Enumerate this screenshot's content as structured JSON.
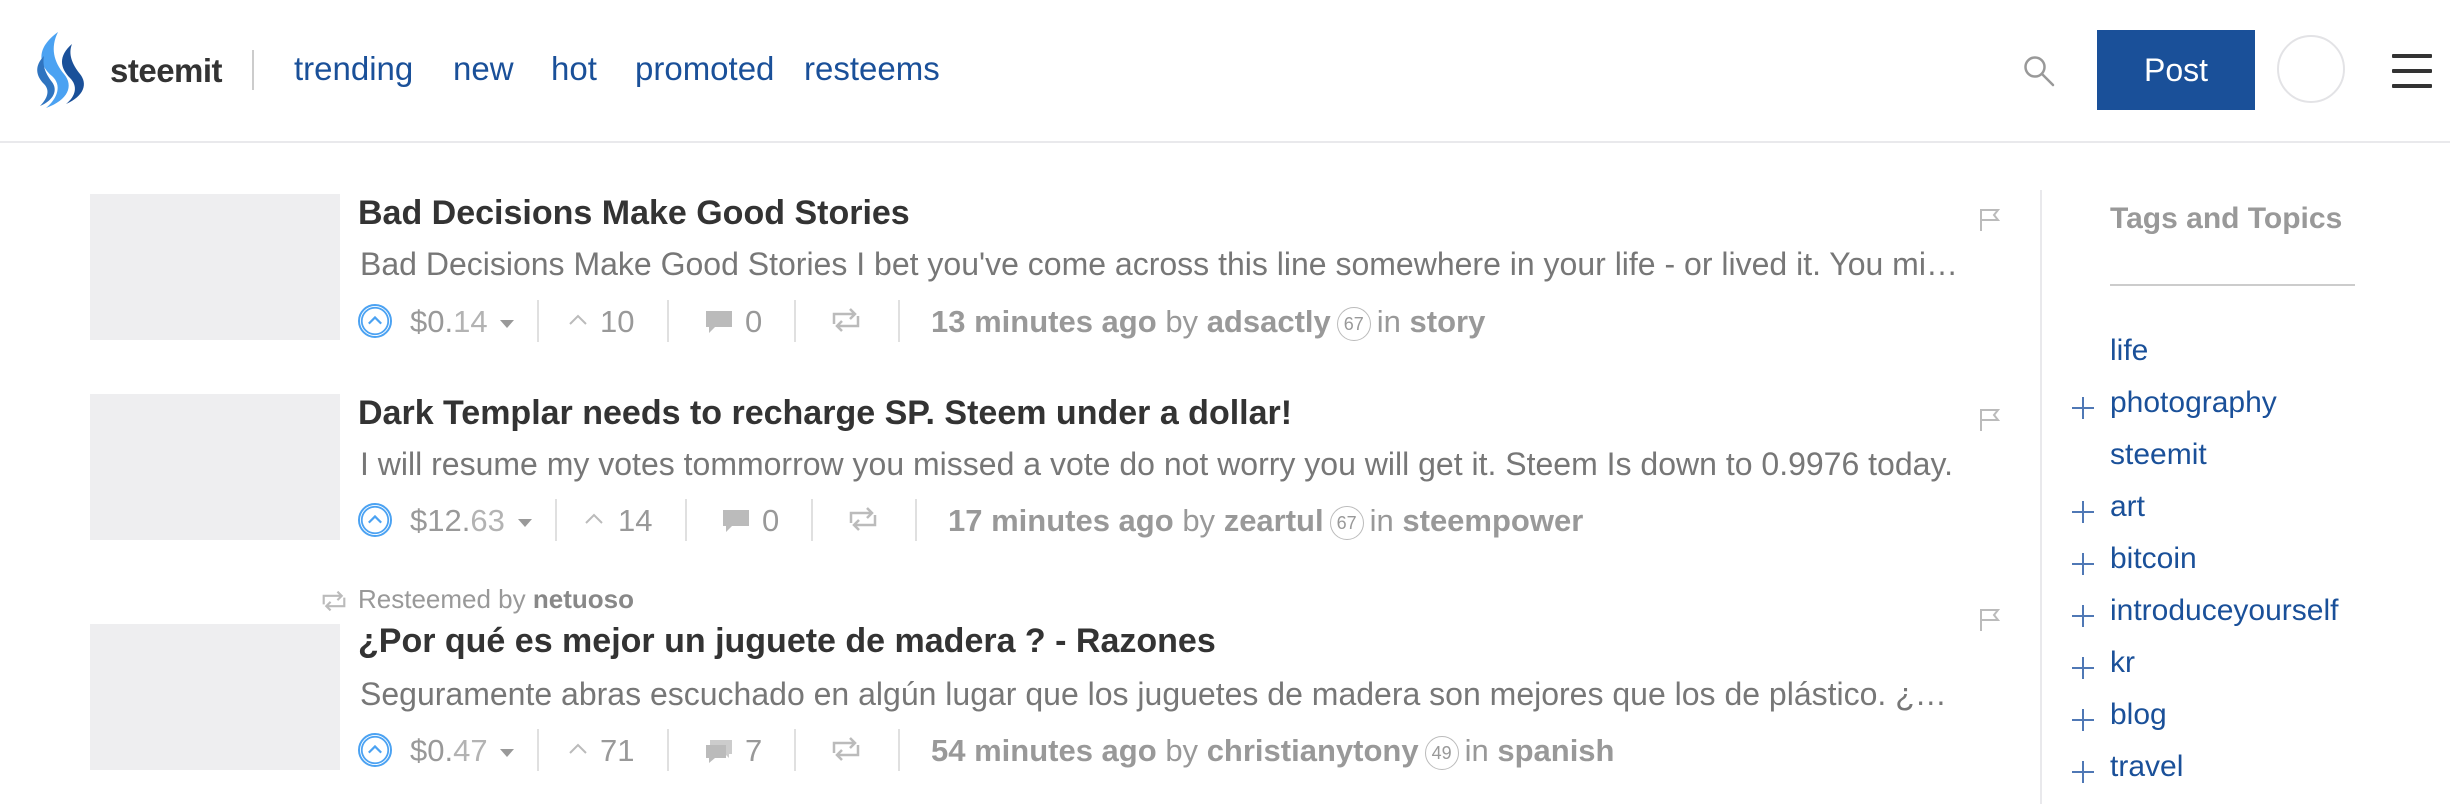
{
  "header": {
    "brand": "steemit",
    "nav": [
      "trending",
      "new",
      "hot",
      "promoted",
      "resteems"
    ],
    "post_label": "Post"
  },
  "posts": [
    {
      "title": "Bad Decisions Make Good Stories",
      "summary": "Bad Decisions Make Good Stories I bet you've come across this line somewhere in your life - or lived it. You might have even said it yourself.",
      "payout_int": "$0.",
      "payout_dec": "14",
      "votes": "10",
      "comments": "0",
      "time": "13 minutes ago",
      "by": "by",
      "author": "adsactly",
      "reputation": "67",
      "in": "in",
      "category": "story"
    },
    {
      "title": "Dark Templar needs to recharge SP. Steem under a dollar!",
      "summary": "I will resume my votes tommorrow you missed a vote do not worry you will get it. Steem Is down to 0.9976 today.",
      "payout_int": "$12.",
      "payout_dec": "63",
      "votes": "14",
      "comments": "0",
      "time": "17 minutes ago",
      "by": "by",
      "author": "zeartul",
      "reputation": "67",
      "in": "in",
      "category": "steempower"
    },
    {
      "resteemed_label": "Resteemed by",
      "resteemed_by": "netuoso",
      "title": "¿Por qué es mejor un juguete de madera ? - Razones",
      "summary": "Seguramente abras escuchado en algún lugar que los juguetes de madera son mejores que los de plástico. ¿Por qué?",
      "payout_int": "$0.",
      "payout_dec": "47",
      "votes": "71",
      "comments": "7",
      "time": "54 minutes ago",
      "by": "by",
      "author": "christianytony",
      "reputation": "49",
      "in": "in",
      "category": "spanish"
    }
  ],
  "sidebar": {
    "title": "Tags and Topics",
    "tags": [
      "life",
      "photography",
      "steemit",
      "art",
      "bitcoin",
      "introduceyourself",
      "kr",
      "blog",
      "travel"
    ]
  },
  "colors": {
    "brand_blue": "#1a5099",
    "upvote_blue": "#4ba2f2",
    "muted": "#999999"
  }
}
